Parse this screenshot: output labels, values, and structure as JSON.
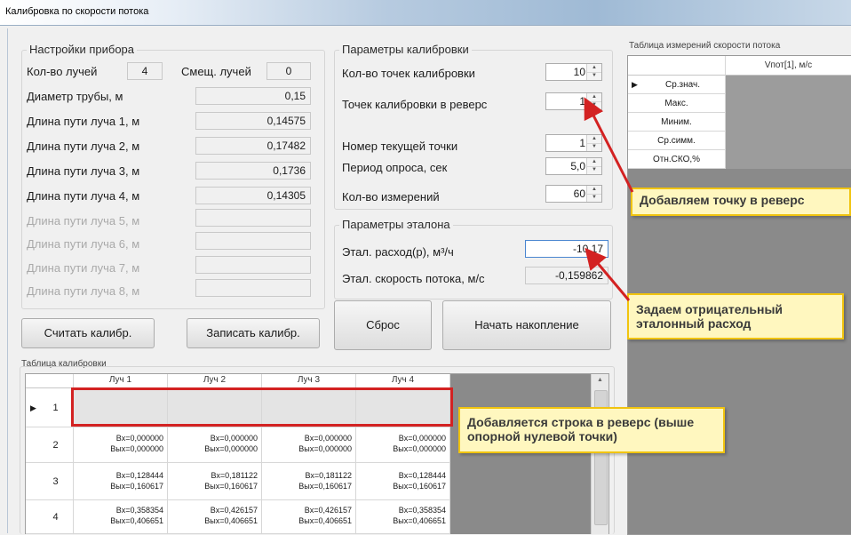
{
  "window_title": "Калибровка по скорости потока",
  "device_settings": {
    "title": "Настройки прибора",
    "beam_count_label": "Кол-во лучей",
    "beam_count": "4",
    "beam_offset_label": "Смещ. лучей",
    "beam_offset": "0",
    "pipe_diameter_label": "Диаметр трубы, м",
    "pipe_diameter": "0,15",
    "paths": [
      {
        "label": "Длина пути луча 1, м",
        "value": "0,14575"
      },
      {
        "label": "Длина пути луча 2, м",
        "value": "0,17482"
      },
      {
        "label": "Длина пути луча 3, м",
        "value": "0,1736"
      },
      {
        "label": "Длина пути луча 4, м",
        "value": "0,14305"
      },
      {
        "label": "Длина пути луча 5, м",
        "value": ""
      },
      {
        "label": "Длина пути луча 6, м",
        "value": ""
      },
      {
        "label": "Длина пути луча 7, м",
        "value": ""
      },
      {
        "label": "Длина пути луча 8, м",
        "value": ""
      }
    ]
  },
  "calibration_params": {
    "title": "Параметры калибровки",
    "points_label": "Кол-во точек калибровки",
    "points": "10",
    "reverse_points_label": "Точек калибровки в реверс",
    "reverse_points": "1",
    "current_point_label": "Номер текущей точки",
    "current_point": "1",
    "poll_period_label": "Период опроса, сек",
    "poll_period": "5,0",
    "measurements_label": "Кол-во измерений",
    "measurements": "60"
  },
  "reference_params": {
    "title": "Параметры эталона",
    "flow_label": "Этал. расход(р), м³/ч",
    "flow": "-10,17",
    "speed_label": "Этал. скорость потока, м/с",
    "speed": "-0,159862"
  },
  "buttons": {
    "read": "Считать калибр.",
    "write": "Записать калибр.",
    "reset": "Сброс",
    "start": "Начать накопление"
  },
  "calib_table": {
    "title": "Таблица калибровки",
    "columns": [
      "Луч 1",
      "Луч 2",
      "Луч 3",
      "Луч 4"
    ],
    "rows": [
      {
        "num": "1",
        "cells": [
          [
            "",
            ""
          ],
          [
            "",
            ""
          ],
          [
            "",
            ""
          ],
          [
            "",
            ""
          ]
        ]
      },
      {
        "num": "2",
        "cells": [
          [
            "Вх=0,000000",
            "Вых=0,000000"
          ],
          [
            "Вх=0,000000",
            "Вых=0,000000"
          ],
          [
            "Вх=0,000000",
            "Вых=0,000000"
          ],
          [
            "Вх=0,000000",
            "Вых=0,000000"
          ]
        ]
      },
      {
        "num": "3",
        "cells": [
          [
            "Вх=0,128444",
            "Вых=0,160617"
          ],
          [
            "Вх=0,181122",
            "Вых=0,160617"
          ],
          [
            "Вх=0,181122",
            "Вых=0,160617"
          ],
          [
            "Вх=0,128444",
            "Вых=0,160617"
          ]
        ]
      },
      {
        "num": "4",
        "cells": [
          [
            "Вх=0,358354",
            "Вых=0,406651"
          ],
          [
            "Вх=0,426157",
            "Вых=0,406651"
          ],
          [
            "Вх=0,426157",
            "Вых=0,406651"
          ],
          [
            "Вх=0,358354",
            "Вых=0,406651"
          ]
        ]
      }
    ]
  },
  "measure_table": {
    "title": "Таблица измерений скорости потока",
    "column": "Vпот[1], м/с",
    "rows": [
      "Ср.знач.",
      "Макс.",
      "Миним.",
      "Ср.симм.",
      "Отн.СКО,%"
    ]
  },
  "annotations": {
    "reverse_point": "Добавляем точку в реверс",
    "negative_flow": "Задаем отрицательный эталонный расход",
    "row_added": "Добавляется строка в реверс (выше опорной нулевой точки)"
  },
  "colors": {
    "highlight": "#d32222",
    "note_bg": "#fff7bf",
    "note_border": "#f1c40f",
    "dark_cell": "#8a8a8a"
  }
}
